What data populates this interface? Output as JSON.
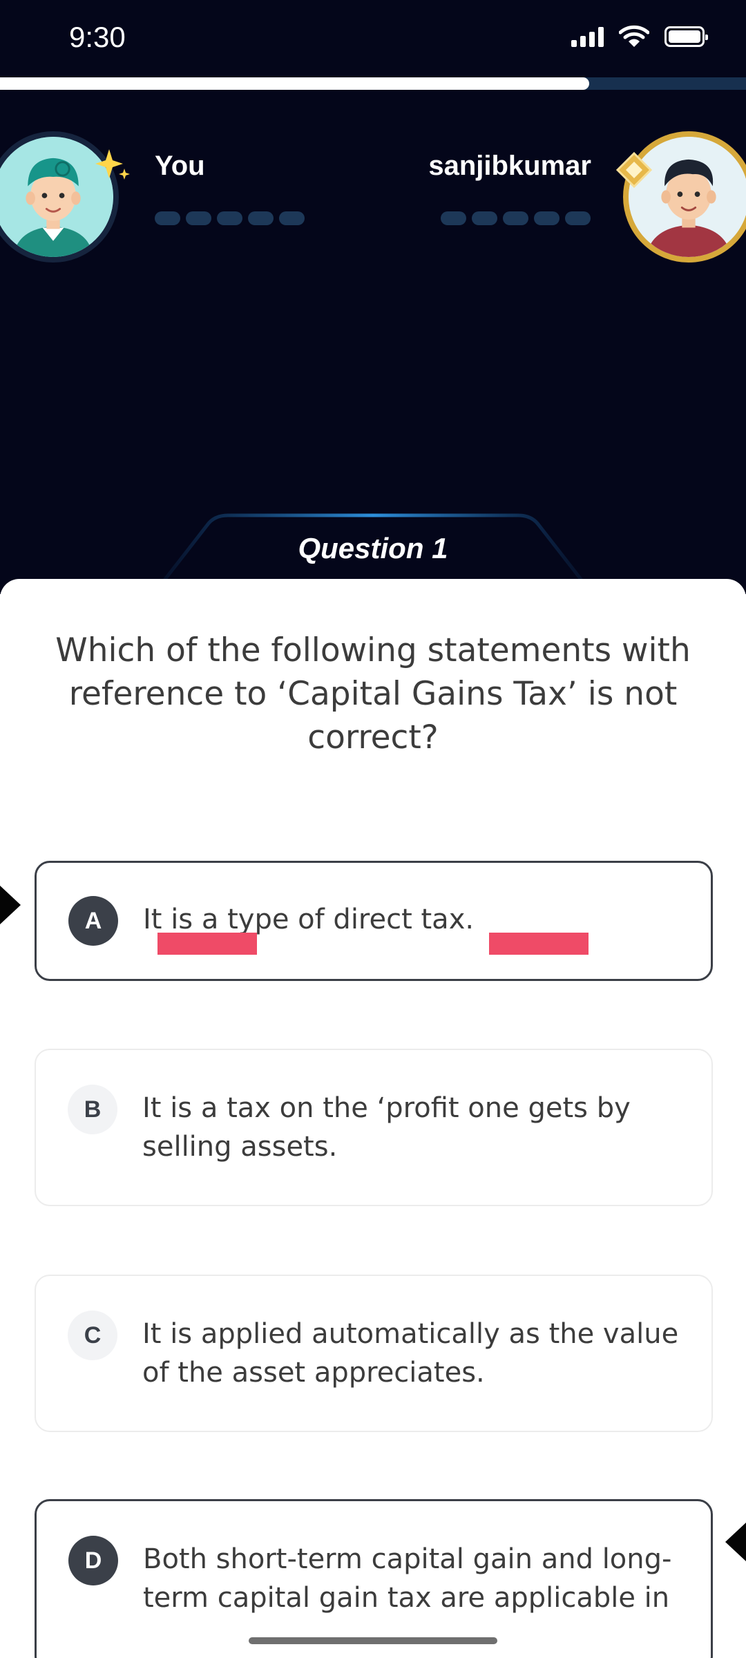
{
  "status_bar": {
    "time": "9:30"
  },
  "timer": {
    "remaining_fraction": 0.79
  },
  "players": {
    "you": {
      "name": "You",
      "progress_dots": 5
    },
    "opponent": {
      "name": "sanjibkumar",
      "progress_dots": 5
    }
  },
  "question": {
    "label": "Question 1",
    "text": "Which of the following statements with reference to ‘Capital Gains Tax’ is not correct?"
  },
  "options": [
    {
      "letter": "A",
      "text": "It is a type of direct tax.",
      "state": "selected"
    },
    {
      "letter": "B",
      "text": "It is a tax on the ‘profit one gets by selling assets.",
      "state": "default"
    },
    {
      "letter": "C",
      "text": "It is applied automatically as the value of the asset appreciates.",
      "state": "default"
    },
    {
      "letter": "D",
      "text": "Both short-term capital gain and long-term capital gain tax are applicable in",
      "state": "selected"
    }
  ],
  "colors": {
    "top_background": "#04061a",
    "progress_fill": "#ffffff",
    "progress_track": "#17304f",
    "answer_marker": "#ef4b67",
    "opponent_ring": "#d6a83a",
    "selected_border": "#3b3f47"
  },
  "icons": [
    "signal-icon",
    "wifi-icon",
    "battery-icon",
    "sparkle-icon",
    "gem-icon"
  ]
}
